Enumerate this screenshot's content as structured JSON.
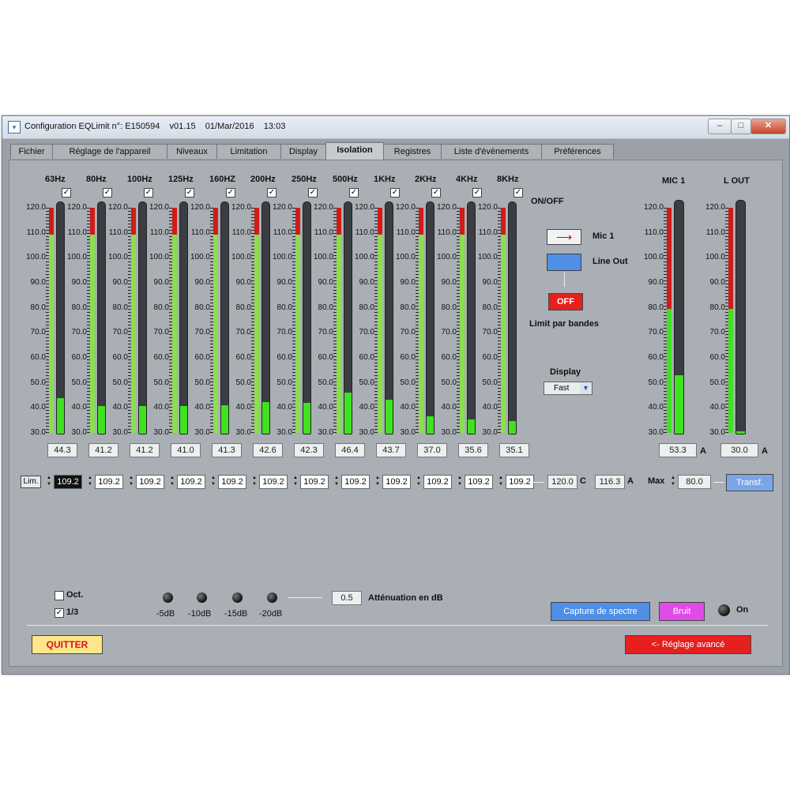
{
  "window": {
    "title": "Configuration EQLimit n°: E150594    v01.15    01/Mar/2016    13:03",
    "controls": [
      "–",
      "□",
      "✕"
    ]
  },
  "tabs": [
    "Fichier",
    "Réglage de l'appareil",
    "Niveaux",
    "Limitation",
    "Display",
    "Isolation",
    "Registres",
    "Liste d'évènements",
    "Préférences"
  ],
  "active_tab": "Isolation",
  "bands": {
    "onoff_label": "ON/OFF",
    "scale": [
      "120.0",
      "110.0",
      "100.0",
      "90.0",
      "80.0",
      "70.0",
      "60.0",
      "50.0",
      "40.0",
      "30.0"
    ],
    "items": [
      {
        "name": "63Hz",
        "checked": "✓",
        "level": 44.3,
        "value": "44.3",
        "limit": "109.2"
      },
      {
        "name": "80Hz",
        "checked": "✓",
        "level": 41.2,
        "value": "41.2",
        "limit": "109.2"
      },
      {
        "name": "100Hz",
        "checked": "✓",
        "level": 41.2,
        "value": "41.2",
        "limit": "109.2"
      },
      {
        "name": "125Hz",
        "checked": "✓",
        "level": 41.0,
        "value": "41.0",
        "limit": "109.2"
      },
      {
        "name": "160HZ",
        "checked": "✓",
        "level": 41.3,
        "value": "41.3",
        "limit": "109.2"
      },
      {
        "name": "200Hz",
        "checked": "✓",
        "level": 42.6,
        "value": "42.6",
        "limit": "109.2"
      },
      {
        "name": "250Hz",
        "checked": "✓",
        "level": 42.3,
        "value": "42.3",
        "limit": "109.2"
      },
      {
        "name": "500Hz",
        "checked": "✓",
        "level": 46.4,
        "value": "46.4",
        "limit": "109.2"
      },
      {
        "name": "1KHz",
        "checked": "✓",
        "level": 43.7,
        "value": "43.7",
        "limit": "109.2"
      },
      {
        "name": "2KHz",
        "checked": "✓",
        "level": 37.0,
        "value": "37.0",
        "limit": "109.2"
      },
      {
        "name": "4KHz",
        "checked": "✓",
        "level": 35.6,
        "value": "35.6",
        "limit": "109.2"
      },
      {
        "name": "8KHz",
        "checked": "✓",
        "level": 35.1,
        "value": "35.1",
        "limit": "109.2"
      }
    ]
  },
  "routing": {
    "mic_label": "Mic 1",
    "line_out_label": "Line Out",
    "limit_button": "OFF",
    "limit_label": "Limit par bandes",
    "arrow": "⟶"
  },
  "display": {
    "label": "Display",
    "selected": "Fast"
  },
  "mic1": {
    "title": "MIC 1",
    "level": 53.3,
    "value": "53.3",
    "unit": "A",
    "scale": [
      "120.0",
      "110.0",
      "100.0",
      "90.0",
      "80.0",
      "70.0",
      "60.0",
      "50.0",
      "40.0",
      "30.0"
    ]
  },
  "lout": {
    "title": "L OUT",
    "level": 30.0,
    "value": "30.0",
    "unit": "A",
    "scale": [
      "120.0",
      "110.0",
      "100.0",
      "90.0",
      "80.0",
      "70.0",
      "60.0",
      "50.0",
      "40.0",
      "30.0"
    ]
  },
  "limits_row": {
    "lim_label": "Lim.",
    "c_value": "120.0",
    "c_unit": "C",
    "a_value": "116.3",
    "a_unit": "A",
    "max_label": "Max",
    "max_value": "80.0",
    "transf_button": "Transf."
  },
  "bottom": {
    "oct_label": "Oct.",
    "oct_checked": "",
    "third_label": "1/3",
    "third_checked": "✓",
    "attenuation_buttons": [
      "-5dB",
      "-10dB",
      "-15dB",
      "-20dB"
    ],
    "attenuation_value": "0.5",
    "attenuation_label": "Atténuation en dB",
    "capture_button": "Capture de spectre",
    "bruit_button": "Bruit",
    "on_label": "On",
    "quit_button": "QUITTER",
    "advanced_button": "<- Réglage avancé"
  },
  "colors": {
    "panel": "#a9afb4",
    "meter_fill": "#3fe21f",
    "red_zone": "#d01b1b",
    "blue_button": "#4f8fe6",
    "magenta_button": "#e04be8",
    "quit_button": "#ffe68a",
    "advanced_button": "#e61f1f"
  }
}
